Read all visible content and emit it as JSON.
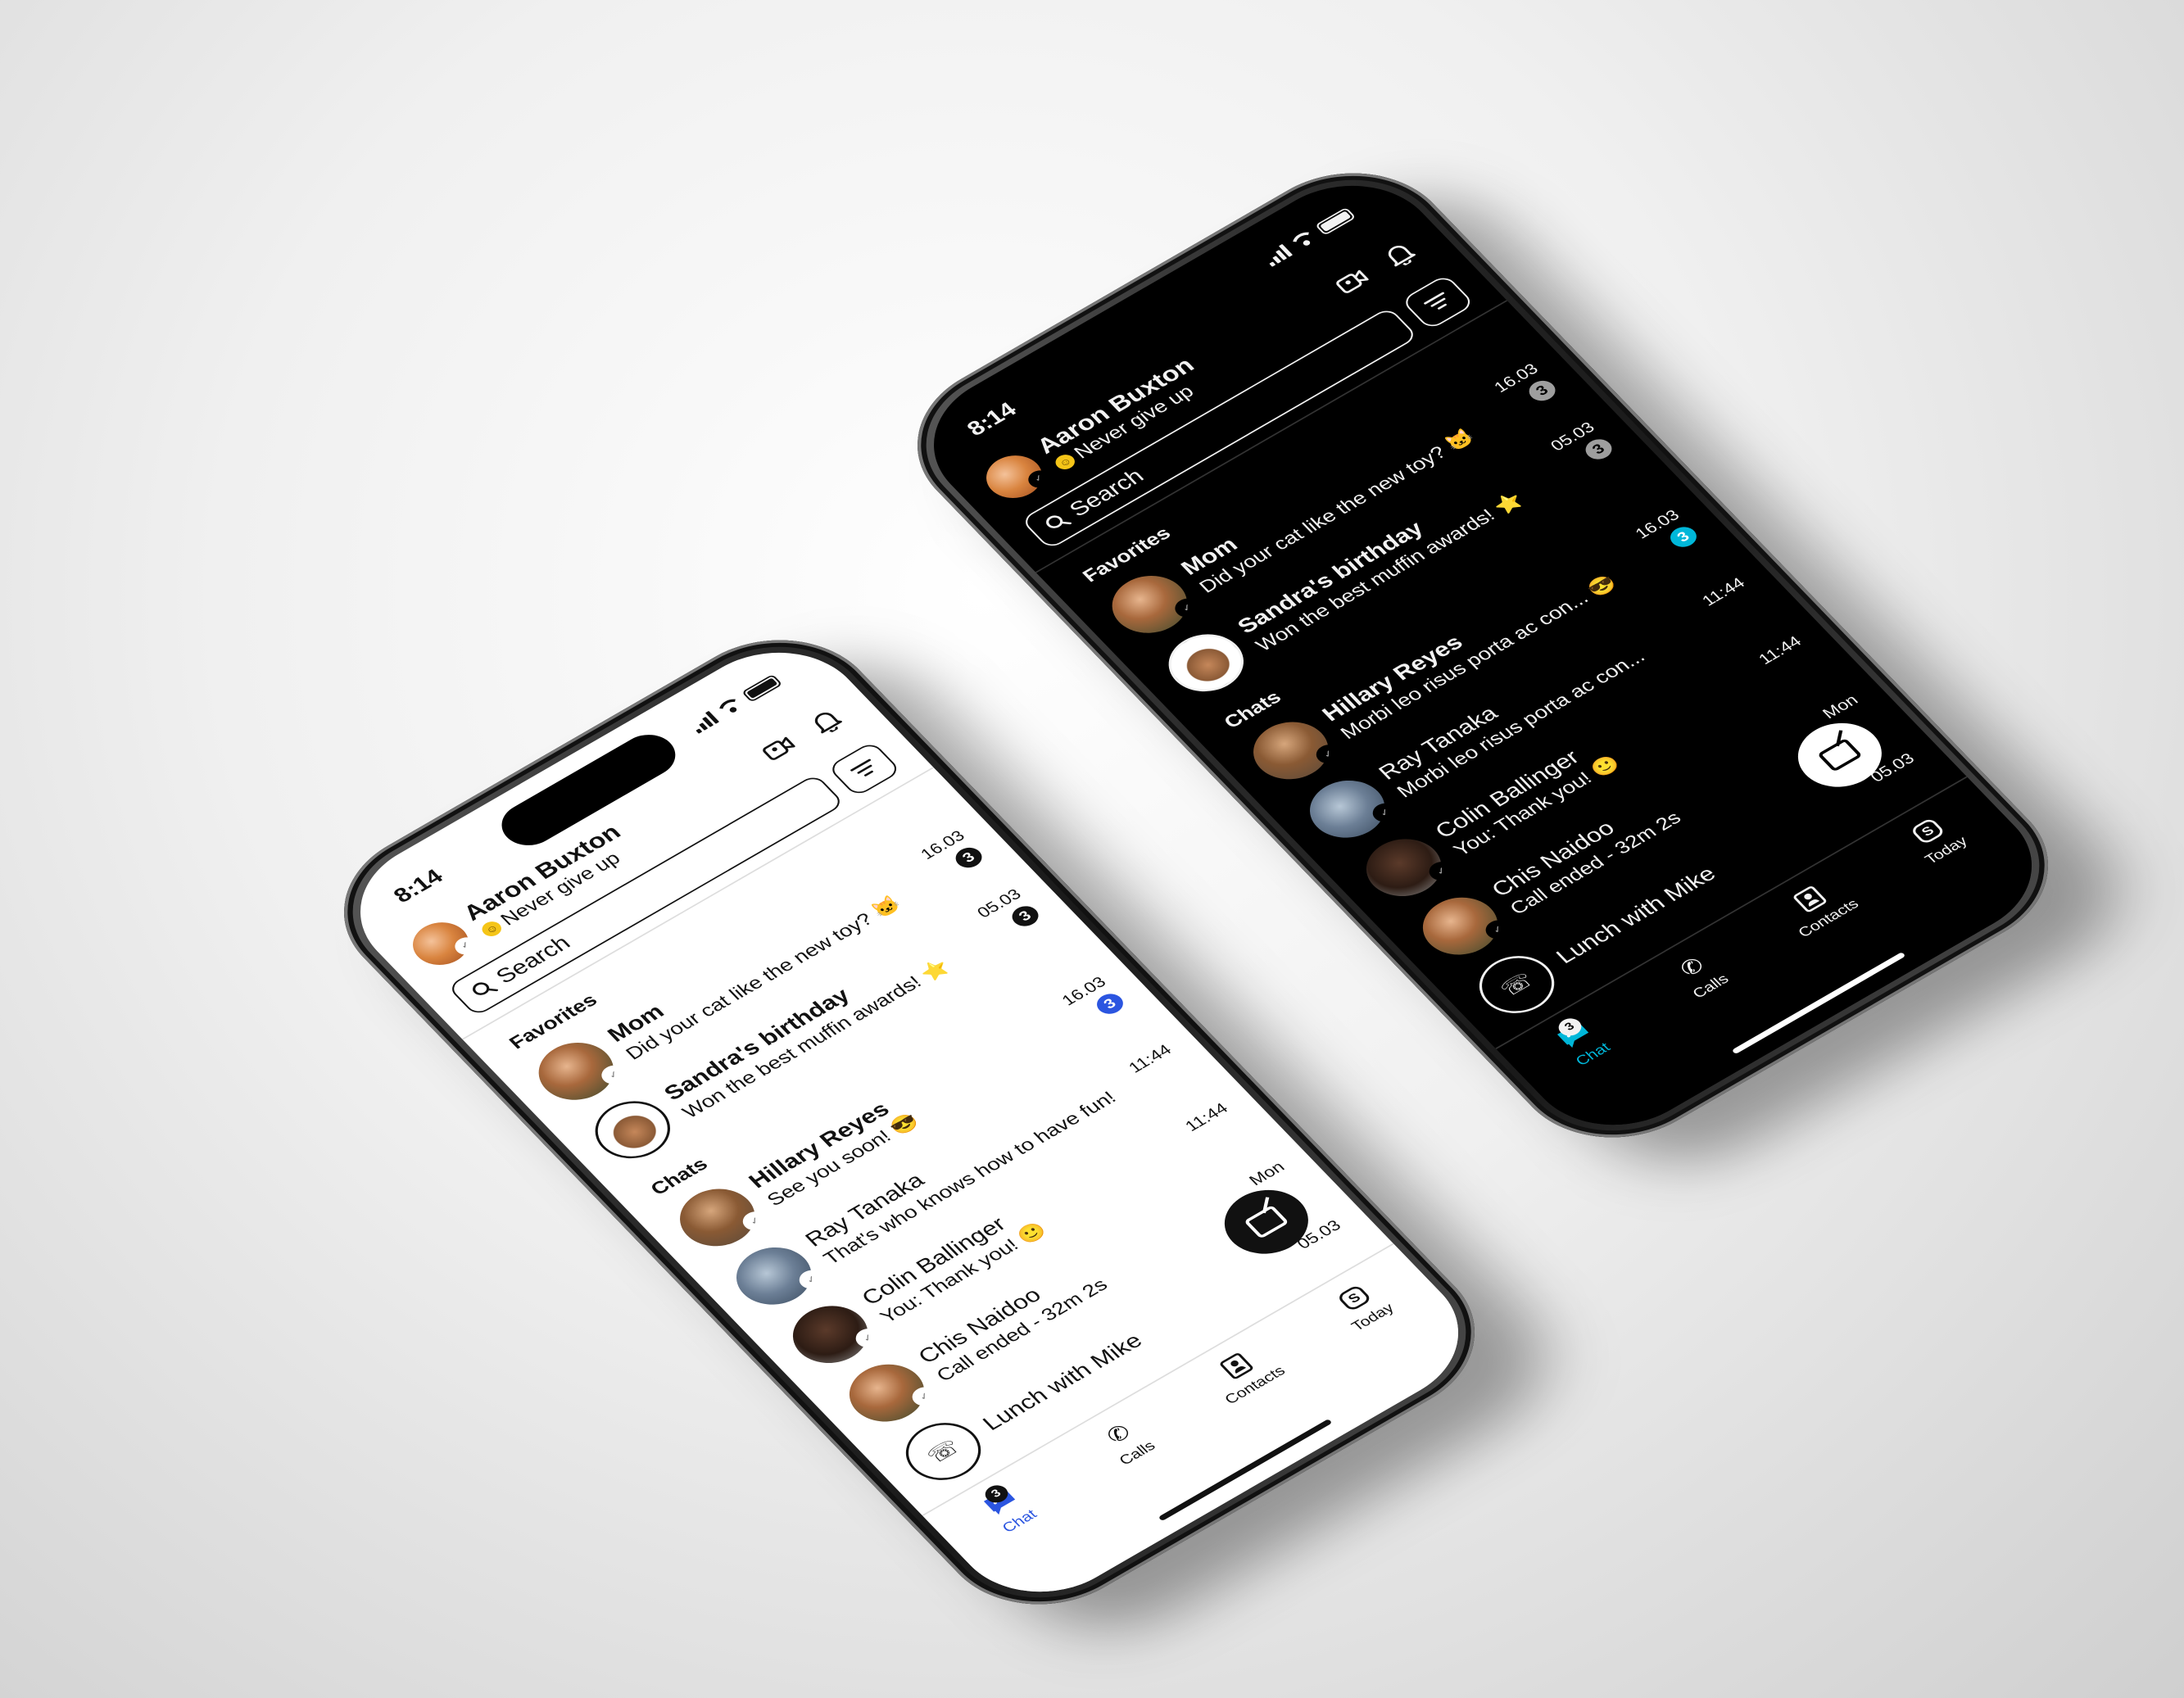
{
  "colors": {
    "accent_blue": "#2b55e0",
    "accent_cyan": "#00b7d9",
    "light_bg": "#ffffff",
    "dark_bg": "#000000"
  },
  "phones": {
    "light": {
      "theme": "light",
      "status_time": "8:14",
      "user_name": "Aaron Buxton",
      "user_status": "Never give up",
      "search_placeholder": "Search",
      "favorites_label": "Favorites",
      "chats_label": "Chats",
      "favorites": [
        {
          "name": "Mom",
          "preview": "Did your cat like the new toy? 🐱",
          "time": "16.03",
          "badge": "3",
          "badge_style": "neutral",
          "bold": true,
          "avatar_icon": "person-avatar"
        },
        {
          "name": "Sandra's birthday",
          "preview": "Won the best muffin awards! ⭐",
          "time": "05.03",
          "badge": "3",
          "badge_style": "neutral",
          "bold": true,
          "avatar_icon": "cake-avatar"
        }
      ],
      "chats": [
        {
          "name": "Hillary Reyes",
          "preview": "See you soon! 😎",
          "time": "16.03",
          "badge": "3",
          "badge_style": "accent",
          "bold": true,
          "avatar_icon": "person-avatar"
        },
        {
          "name": "Ray Tanaka",
          "preview": "That's who knows how to have fun!",
          "time": "11:44",
          "badge": "",
          "bold": false,
          "avatar_icon": "person-avatar"
        },
        {
          "name": "Colin Ballinger",
          "preview": "You: Thank you! 🙂",
          "time": "11:44",
          "badge": "",
          "bold": false,
          "avatar_icon": "person-avatar"
        },
        {
          "name": "Chis Naidoo",
          "preview": "Call ended - 32m 2s",
          "time": "Mon",
          "badge": "",
          "bold": false,
          "avatar_icon": "person-avatar"
        },
        {
          "name": "Lunch with Mike",
          "preview": "",
          "time": "05.03",
          "badge": "",
          "bold": false,
          "avatar_icon": "phone-avatar"
        }
      ],
      "tabs": [
        {
          "label": "Chat",
          "icon": "chat-icon",
          "badge": "3",
          "active": true
        },
        {
          "label": "Calls",
          "icon": "calls-icon",
          "badge": "",
          "active": false
        },
        {
          "label": "Contacts",
          "icon": "contacts-icon",
          "badge": "",
          "active": false
        },
        {
          "label": "Today",
          "icon": "today-icon",
          "badge": "",
          "active": false
        }
      ]
    },
    "dark": {
      "theme": "dark",
      "status_time": "8:14",
      "user_name": "Aaron Buxton",
      "user_status": "Never give up",
      "search_placeholder": "Search",
      "favorites_label": "Favorites",
      "chats_label": "Chats",
      "favorites": [
        {
          "name": "Mom",
          "preview": "Did your cat like the new toy? 🐱",
          "time": "16.03",
          "badge": "3",
          "badge_style": "neutral",
          "bold": true,
          "avatar_icon": "person-avatar"
        },
        {
          "name": "Sandra's birthday",
          "preview": "Won the best muffin awards! ⭐",
          "time": "05.03",
          "badge": "3",
          "badge_style": "neutral",
          "bold": true,
          "avatar_icon": "cake-avatar"
        }
      ],
      "chats": [
        {
          "name": "Hillary Reyes",
          "preview": "Morbi leo risus porta ac con... 😎",
          "time": "16.03",
          "badge": "3",
          "badge_style": "accent",
          "bold": true,
          "avatar_icon": "person-avatar"
        },
        {
          "name": "Ray Tanaka",
          "preview": "Morbi leo risus porta ac con...",
          "time": "11:44",
          "badge": "",
          "bold": false,
          "avatar_icon": "person-avatar"
        },
        {
          "name": "Colin Ballinger",
          "preview": "You: Thank you! 🙂",
          "time": "11:44",
          "badge": "",
          "bold": false,
          "avatar_icon": "person-avatar"
        },
        {
          "name": "Chis Naidoo",
          "preview": "Call ended - 32m 2s",
          "time": "Mon",
          "badge": "",
          "bold": false,
          "avatar_icon": "person-avatar"
        },
        {
          "name": "Lunch with Mike",
          "preview": "",
          "time": "05.03",
          "badge": "",
          "bold": false,
          "avatar_icon": "phone-avatar"
        }
      ],
      "tabs": [
        {
          "label": "Chat",
          "icon": "chat-icon",
          "badge": "3",
          "active": true
        },
        {
          "label": "Calls",
          "icon": "calls-icon",
          "badge": "",
          "active": false
        },
        {
          "label": "Contacts",
          "icon": "contacts-icon",
          "badge": "",
          "active": false
        },
        {
          "label": "Today",
          "icon": "today-icon",
          "badge": "",
          "active": false
        }
      ]
    }
  }
}
